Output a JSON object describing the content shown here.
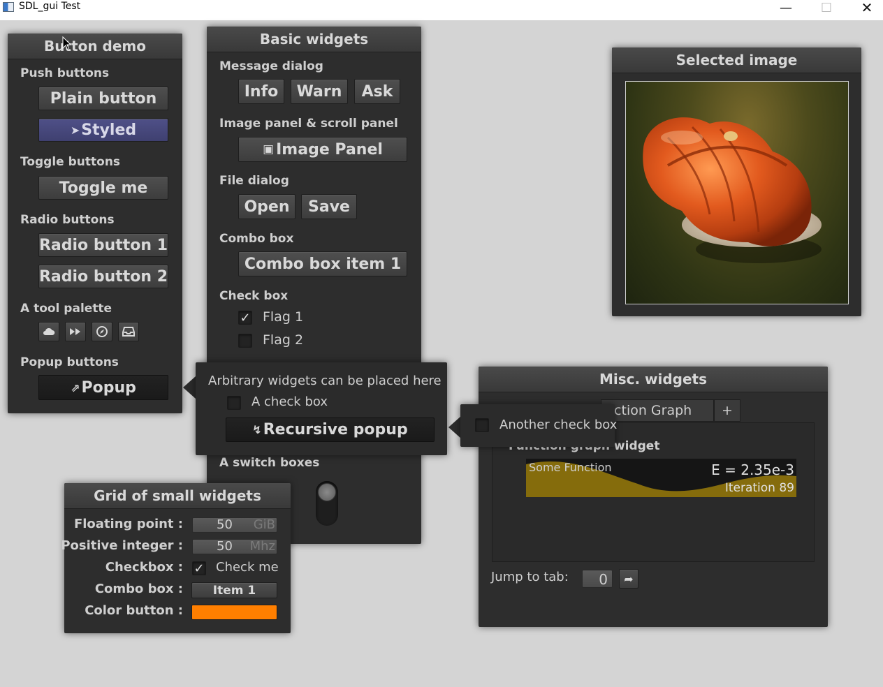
{
  "window": {
    "title": "SDL_gui Test"
  },
  "button_demo": {
    "title": "Button demo",
    "push_label": "Push buttons",
    "plain_button": "Plain button",
    "styled_button": "Styled",
    "toggle_label": "Toggle buttons",
    "toggle_button": "Toggle me",
    "radio_label": "Radio buttons",
    "radio_1": "Radio button 1",
    "radio_2": "Radio button 2",
    "palette_label": "A tool palette",
    "palette_icons": [
      "cloud-icon",
      "fast-forward-icon",
      "compass-icon",
      "inbox-icon"
    ],
    "popup_label": "Popup buttons",
    "popup_button": "Popup",
    "styled_color": "#4b4c82"
  },
  "basic_widgets": {
    "title": "Basic widgets",
    "message_label": "Message dialog",
    "info": "Info",
    "warn": "Warn",
    "ask": "Ask",
    "image_label": "Image panel & scroll panel",
    "image_panel_button": "Image Panel",
    "file_label": "File dialog",
    "open": "Open",
    "save": "Save",
    "combo_label": "Combo box",
    "combo_value": "Combo box item 1",
    "check_label": "Check box",
    "flag1": "Flag 1",
    "flag1_checked": true,
    "flag2": "Flag 2",
    "flag2_checked": false,
    "switch_label": "A switch boxes"
  },
  "popup": {
    "text": "Arbitrary widgets can be placed here",
    "check_label": "A check box",
    "recursive_button": "Recursive popup"
  },
  "popup2": {
    "check_label": "Another check box"
  },
  "grid": {
    "title": "Grid of small widgets",
    "float_label": "Floating point :",
    "float_value": "50",
    "float_unit": "GiB",
    "int_label": "Positive integer :",
    "int_value": "50",
    "int_unit": "Mhz",
    "checkbox_label": "Checkbox :",
    "checkbox_text": "Check me",
    "checkbox_checked": true,
    "combo_label": "Combo box :",
    "combo_value": "Item 1",
    "color_label": "Color button :",
    "color_value": "#ff7f00"
  },
  "selected_image": {
    "title": "Selected image"
  },
  "misc": {
    "title": "Misc. widgets",
    "tab_label": "Function Graph",
    "tab_visible_text": "nction Graph",
    "add_tab": "+",
    "graph_label": "Function graph widget",
    "graph_caption": "Some Function",
    "graph_header": "E = 2.35e-3",
    "graph_footer": "Iteration 89",
    "jump_label": "Jump to tab:",
    "jump_value": "0"
  }
}
